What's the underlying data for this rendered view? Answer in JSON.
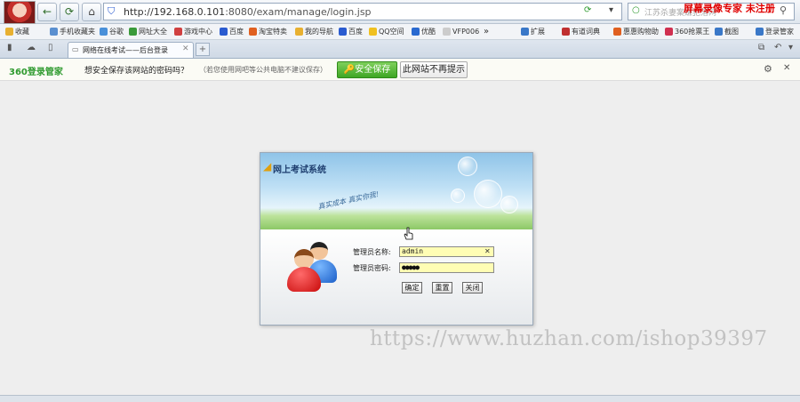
{
  "browser": {
    "address_host": "http://192.168.0.101",
    "address_path": ":8080/exam/manage/login.jsp",
    "search_text": "江苏杀妻案嫌犯落网",
    "recorder_watermark": "屏幕录像专家 未注册"
  },
  "bookmarks": [
    {
      "label": "收藏",
      "color": "#e8b030"
    },
    {
      "label": "手机收藏夹",
      "color": "#5a8fd0"
    },
    {
      "label": "谷歌",
      "color": "#4a90d9"
    },
    {
      "label": "网址大全",
      "color": "#3a9a3a"
    },
    {
      "label": "游戏中心",
      "color": "#d04040"
    },
    {
      "label": "百度",
      "color": "#2a5bd0"
    },
    {
      "label": "淘宝特卖",
      "color": "#e06020"
    },
    {
      "label": "我的导航",
      "color": "#e8b030"
    },
    {
      "label": "百度",
      "color": "#2a5bd0"
    },
    {
      "label": "QQ空间",
      "color": "#f0c020"
    },
    {
      "label": "优酷",
      "color": "#2a6ad0"
    },
    {
      "label": "VFP006",
      "color": "#cccccc"
    },
    {
      "label": "扩展",
      "color": "#3a78c8"
    },
    {
      "label": "有道词典",
      "color": "#c03030"
    },
    {
      "label": "惠惠购物助",
      "color": "#e06020"
    },
    {
      "label": "360抢票王",
      "color": "#d03050"
    },
    {
      "label": "截图",
      "color": "#3a78c8"
    },
    {
      "label": "登录管家",
      "color": "#3a78c8"
    }
  ],
  "tab": {
    "title": "网络在线考试——后台登录"
  },
  "password_bar": {
    "logo": "360登录管家",
    "question": "想安全保存该网站的密码吗？",
    "hint": "（若您使用网吧等公共电脑不建议保存）",
    "save_label": "安全保存",
    "never_label": "此网站不再提示"
  },
  "login": {
    "system_title": "网上考试系统",
    "slogan": "真实成本 真实你我!",
    "username_label": "管理员名称:",
    "username_value": "admin",
    "password_label": "管理员密码:",
    "password_value": "●●●●●",
    "confirm_label": "确定",
    "reset_label": "重置",
    "close_label": "关闭"
  },
  "watermark": "https://www.huzhan.com/ishop39397",
  "colors": {
    "accent_green": "#3ea624",
    "brand_red": "#e00000"
  }
}
